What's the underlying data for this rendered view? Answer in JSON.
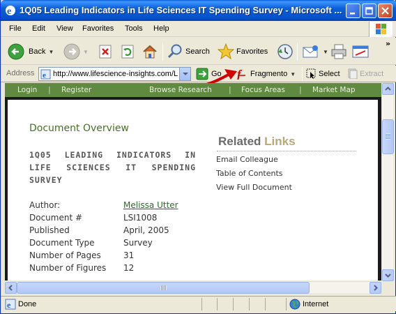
{
  "window": {
    "title": "1Q05 Leading Indicators in Life Sciences IT Spending Survey - Microsoft ..."
  },
  "menu": {
    "items": [
      "File",
      "Edit",
      "View",
      "Favorites",
      "Tools",
      "Help"
    ]
  },
  "toolbar": {
    "back_label": "Back",
    "search_label": "Search",
    "favorites_label": "Favorites"
  },
  "address": {
    "label": "Address",
    "url": "http://www.lifescience-insights.com/L",
    "go_label": "Go",
    "fragmento_label": "Fragmento",
    "select_label": "Select",
    "extract_label": "Extract"
  },
  "site_nav": {
    "login": "Login",
    "register": "Register",
    "browse": "Browse Research",
    "focus": "Focus Areas",
    "market": "Market Map"
  },
  "document": {
    "section_title": "Document Overview",
    "heading": "1Q05 LEADING INDICATORS IN LIFE SCIENCES IT SPENDING SURVEY",
    "meta": [
      {
        "key": "Author:",
        "value": "Melissa Utter"
      },
      {
        "key": "Document #",
        "value": "LSI1008"
      },
      {
        "key": "Published",
        "value": "April, 2005"
      },
      {
        "key": "Document Type",
        "value": "Survey"
      },
      {
        "key": "Number of Pages",
        "value": "31"
      },
      {
        "key": "Number of Figures",
        "value": "12"
      }
    ]
  },
  "related": {
    "title_part1": "Related",
    "title_part2": "Links",
    "links": [
      "Email Colleague",
      "Table of Contents",
      "View Full Document"
    ]
  },
  "status": {
    "text": "Done",
    "zone": "Internet"
  },
  "colors": {
    "titlebar": "#0a5fd8",
    "site_nav": "#5f8a40",
    "section_title": "#4a6f2a",
    "related_accent": "#b8a978",
    "annotation_arrow": "#d40000"
  }
}
